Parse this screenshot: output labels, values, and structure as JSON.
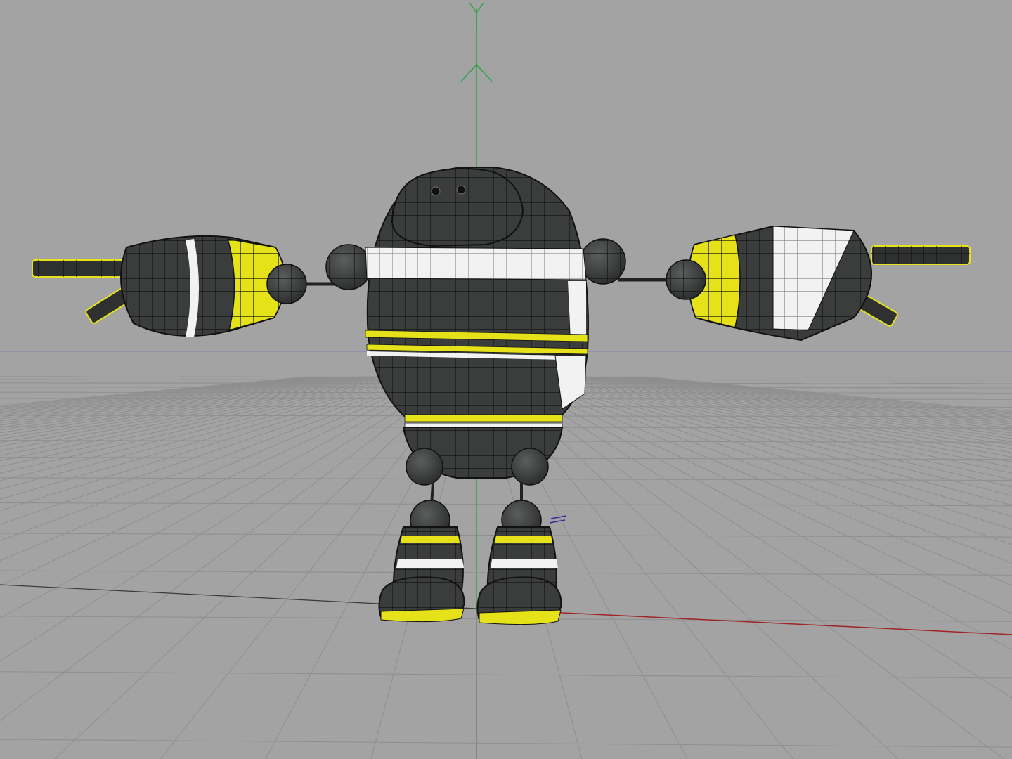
{
  "viewport": {
    "background": "#a3a3a3",
    "grid_color": "#8e8e8e",
    "grid_major_color": "#6a6a6a"
  },
  "axes": {
    "y_label": "Y",
    "y_color": "#2fa24a",
    "x_color": "#a02424",
    "horizon_color": "#7a80b8",
    "z_color": "#2a2a9a"
  },
  "model": {
    "name_icon": "robot-model",
    "body_color": "#3a3d3c",
    "stripe_white": "#f2f2f2",
    "stripe_yellow": "#e6e21a",
    "wire_color": "#111111"
  }
}
